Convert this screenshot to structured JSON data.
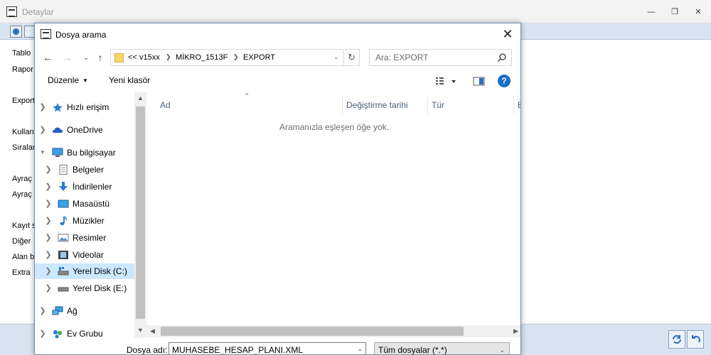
{
  "app": {
    "title": "Detaylar",
    "labels": [
      "Tablo",
      "Rapor",
      "Export",
      "Kullan",
      "Sıralan",
      "Ayraç",
      "Ayraç",
      "Kayıt s",
      "Diğer",
      "Alan b",
      "Extra"
    ],
    "window_controls": [
      "minimize-icon",
      "maximize-icon",
      "close-icon"
    ]
  },
  "dialog": {
    "title": "Dosya arama",
    "close_glyph": "✕",
    "address": {
      "overflow": "<<",
      "crumbs": [
        "v15xx",
        "MİKRO_1513F",
        "EXPORT"
      ]
    },
    "search": {
      "placeholder": "Ara: EXPORT"
    },
    "commands": {
      "organize": "Düzenle",
      "new_folder": "Yeni klasör"
    },
    "help_glyph": "?",
    "nav_items": [
      {
        "label": "Hızlı erişim",
        "icon": "star-icon"
      },
      {
        "label": "OneDrive",
        "icon": "cloud-icon"
      },
      {
        "label": "Bu bilgisayar",
        "icon": "computer-icon"
      },
      {
        "label": "Belgeler",
        "icon": "documents-icon"
      },
      {
        "label": "İndirilenler",
        "icon": "downloads-icon"
      },
      {
        "label": "Masaüstü",
        "icon": "desktop-icon"
      },
      {
        "label": "Müzikler",
        "icon": "music-icon"
      },
      {
        "label": "Resimler",
        "icon": "pictures-icon"
      },
      {
        "label": "Videolar",
        "icon": "videos-icon"
      },
      {
        "label": "Yerel Disk (C:)",
        "icon": "drive-c-icon",
        "selected": true
      },
      {
        "label": "Yerel Disk (E:)",
        "icon": "drive-icon"
      },
      {
        "label": "Ağ",
        "icon": "network-icon"
      },
      {
        "label": "Ev Grubu",
        "icon": "homegroup-icon"
      }
    ],
    "columns": [
      "Ad",
      "Değiştirme tarihi",
      "Tür",
      "B"
    ],
    "empty_message": "Aramanızla eşleşen öğe yok.",
    "filename_label": "Dosya adı:",
    "filename_value": "MUHASEBE_HESAP_PLANI.XML",
    "filetype_value": "Tüm dosyalar (*.*)"
  }
}
